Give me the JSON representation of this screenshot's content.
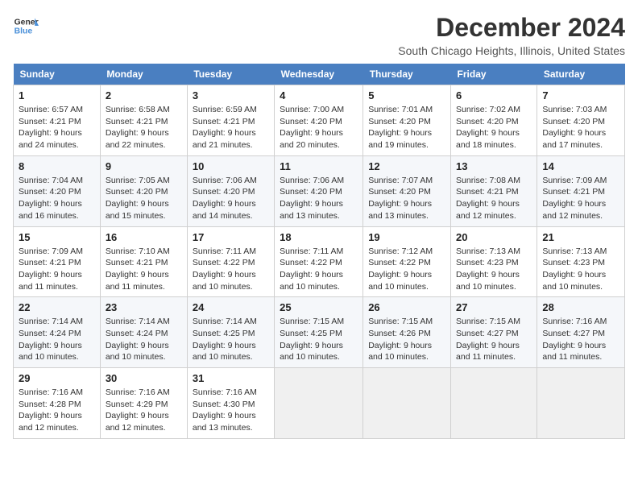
{
  "logo": {
    "line1": "General",
    "line2": "Blue"
  },
  "title": "December 2024",
  "location": "South Chicago Heights, Illinois, United States",
  "days_of_week": [
    "Sunday",
    "Monday",
    "Tuesday",
    "Wednesday",
    "Thursday",
    "Friday",
    "Saturday"
  ],
  "weeks": [
    [
      {
        "day": "1",
        "info": "Sunrise: 6:57 AM\nSunset: 4:21 PM\nDaylight: 9 hours and 24 minutes."
      },
      {
        "day": "2",
        "info": "Sunrise: 6:58 AM\nSunset: 4:21 PM\nDaylight: 9 hours and 22 minutes."
      },
      {
        "day": "3",
        "info": "Sunrise: 6:59 AM\nSunset: 4:21 PM\nDaylight: 9 hours and 21 minutes."
      },
      {
        "day": "4",
        "info": "Sunrise: 7:00 AM\nSunset: 4:20 PM\nDaylight: 9 hours and 20 minutes."
      },
      {
        "day": "5",
        "info": "Sunrise: 7:01 AM\nSunset: 4:20 PM\nDaylight: 9 hours and 19 minutes."
      },
      {
        "day": "6",
        "info": "Sunrise: 7:02 AM\nSunset: 4:20 PM\nDaylight: 9 hours and 18 minutes."
      },
      {
        "day": "7",
        "info": "Sunrise: 7:03 AM\nSunset: 4:20 PM\nDaylight: 9 hours and 17 minutes."
      }
    ],
    [
      {
        "day": "8",
        "info": "Sunrise: 7:04 AM\nSunset: 4:20 PM\nDaylight: 9 hours and 16 minutes."
      },
      {
        "day": "9",
        "info": "Sunrise: 7:05 AM\nSunset: 4:20 PM\nDaylight: 9 hours and 15 minutes."
      },
      {
        "day": "10",
        "info": "Sunrise: 7:06 AM\nSunset: 4:20 PM\nDaylight: 9 hours and 14 minutes."
      },
      {
        "day": "11",
        "info": "Sunrise: 7:06 AM\nSunset: 4:20 PM\nDaylight: 9 hours and 13 minutes."
      },
      {
        "day": "12",
        "info": "Sunrise: 7:07 AM\nSunset: 4:20 PM\nDaylight: 9 hours and 13 minutes."
      },
      {
        "day": "13",
        "info": "Sunrise: 7:08 AM\nSunset: 4:21 PM\nDaylight: 9 hours and 12 minutes."
      },
      {
        "day": "14",
        "info": "Sunrise: 7:09 AM\nSunset: 4:21 PM\nDaylight: 9 hours and 12 minutes."
      }
    ],
    [
      {
        "day": "15",
        "info": "Sunrise: 7:09 AM\nSunset: 4:21 PM\nDaylight: 9 hours and 11 minutes."
      },
      {
        "day": "16",
        "info": "Sunrise: 7:10 AM\nSunset: 4:21 PM\nDaylight: 9 hours and 11 minutes."
      },
      {
        "day": "17",
        "info": "Sunrise: 7:11 AM\nSunset: 4:22 PM\nDaylight: 9 hours and 10 minutes."
      },
      {
        "day": "18",
        "info": "Sunrise: 7:11 AM\nSunset: 4:22 PM\nDaylight: 9 hours and 10 minutes."
      },
      {
        "day": "19",
        "info": "Sunrise: 7:12 AM\nSunset: 4:22 PM\nDaylight: 9 hours and 10 minutes."
      },
      {
        "day": "20",
        "info": "Sunrise: 7:13 AM\nSunset: 4:23 PM\nDaylight: 9 hours and 10 minutes."
      },
      {
        "day": "21",
        "info": "Sunrise: 7:13 AM\nSunset: 4:23 PM\nDaylight: 9 hours and 10 minutes."
      }
    ],
    [
      {
        "day": "22",
        "info": "Sunrise: 7:14 AM\nSunset: 4:24 PM\nDaylight: 9 hours and 10 minutes."
      },
      {
        "day": "23",
        "info": "Sunrise: 7:14 AM\nSunset: 4:24 PM\nDaylight: 9 hours and 10 minutes."
      },
      {
        "day": "24",
        "info": "Sunrise: 7:14 AM\nSunset: 4:25 PM\nDaylight: 9 hours and 10 minutes."
      },
      {
        "day": "25",
        "info": "Sunrise: 7:15 AM\nSunset: 4:25 PM\nDaylight: 9 hours and 10 minutes."
      },
      {
        "day": "26",
        "info": "Sunrise: 7:15 AM\nSunset: 4:26 PM\nDaylight: 9 hours and 10 minutes."
      },
      {
        "day": "27",
        "info": "Sunrise: 7:15 AM\nSunset: 4:27 PM\nDaylight: 9 hours and 11 minutes."
      },
      {
        "day": "28",
        "info": "Sunrise: 7:16 AM\nSunset: 4:27 PM\nDaylight: 9 hours and 11 minutes."
      }
    ],
    [
      {
        "day": "29",
        "info": "Sunrise: 7:16 AM\nSunset: 4:28 PM\nDaylight: 9 hours and 12 minutes."
      },
      {
        "day": "30",
        "info": "Sunrise: 7:16 AM\nSunset: 4:29 PM\nDaylight: 9 hours and 12 minutes."
      },
      {
        "day": "31",
        "info": "Sunrise: 7:16 AM\nSunset: 4:30 PM\nDaylight: 9 hours and 13 minutes."
      },
      null,
      null,
      null,
      null
    ]
  ]
}
